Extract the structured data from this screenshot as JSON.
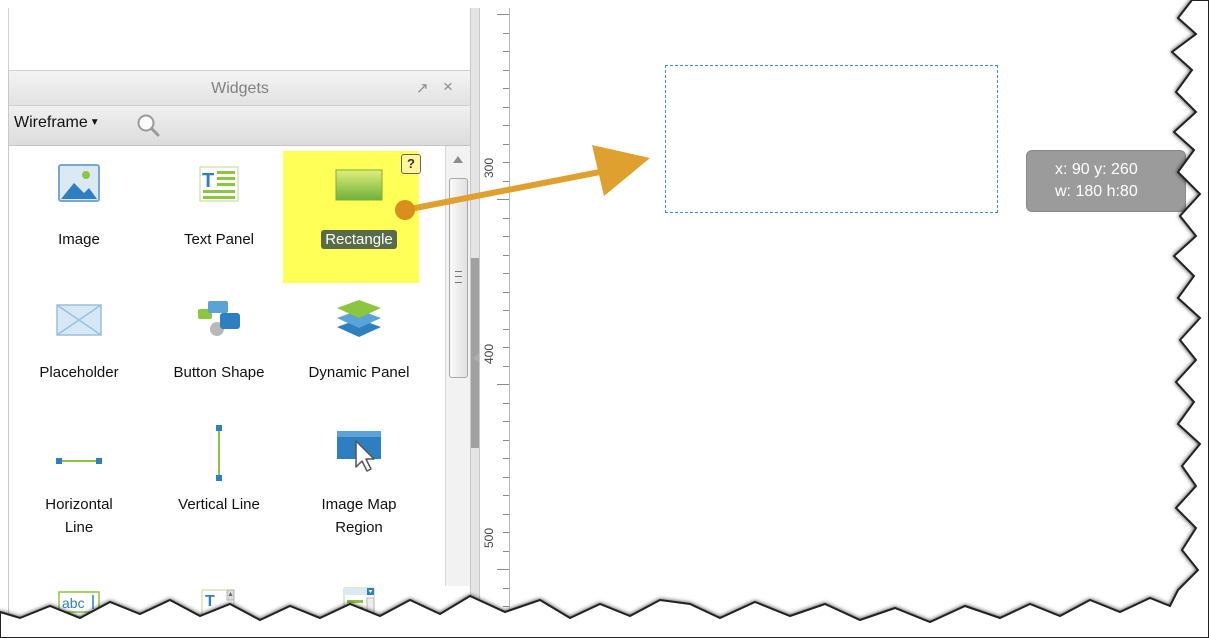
{
  "widgets_panel": {
    "title": "Widgets",
    "undock_icon": "undock-arrow-icon",
    "close_icon": "close-icon",
    "library": {
      "selected": "Wireframe"
    },
    "search_icon": "magnifier-icon",
    "help_badge": "?",
    "widgets": [
      {
        "label": "Image",
        "icon": "image-icon"
      },
      {
        "label": "Text Panel",
        "icon": "text-panel-icon"
      },
      {
        "label": "Rectangle",
        "icon": "rectangle-icon",
        "highlighted": true
      },
      {
        "label": "Placeholder",
        "icon": "placeholder-icon"
      },
      {
        "label": "Button Shape",
        "icon": "button-shape-icon"
      },
      {
        "label": "Dynamic Panel",
        "icon": "dynamic-panel-icon"
      },
      {
        "label": "Horizontal Line",
        "label_line1": "Horizontal",
        "label_line2": "Line",
        "icon": "horizontal-line-icon"
      },
      {
        "label": "Vertical Line",
        "icon": "vertical-line-icon"
      },
      {
        "label": "Image Map Region",
        "label_line1": "Image Map",
        "label_line2": "Region",
        "icon": "image-map-region-icon"
      }
    ],
    "partial_widgets": [
      {
        "text": "abc",
        "icon": "text-field-icon"
      },
      {
        "text": "T",
        "icon": "text-area-icon"
      },
      {
        "icon": "droplist-icon"
      }
    ]
  },
  "ruler": {
    "labels": [
      "300",
      "400",
      "500"
    ]
  },
  "canvas": {
    "coords_tooltip": {
      "line1": "x: 90  y: 260",
      "line2": "w: 180  h:80"
    },
    "drag_arrow_color": "#E0A030",
    "selection_color": "#3B8FD9"
  },
  "colors": {
    "highlight": "#FFFF58",
    "tooltip_bg": "#9B9B9B"
  }
}
